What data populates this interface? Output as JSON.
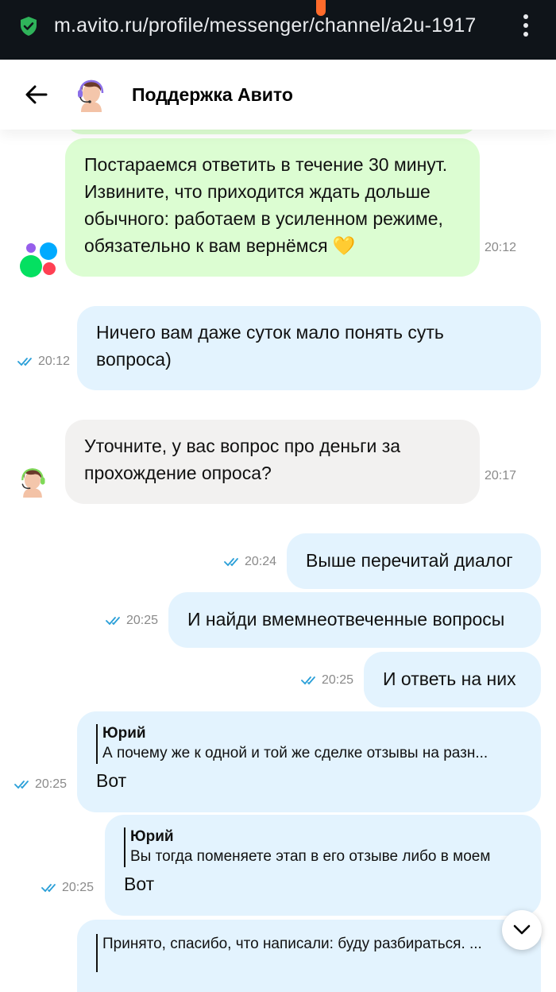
{
  "browser": {
    "url": "m.avito.ru/profile/messenger/channel/a2u-1917",
    "secure_icon": "shield-check-icon",
    "menu_icon": "kebab-menu-icon"
  },
  "header": {
    "title": "Поддержка Авито",
    "back_icon": "arrow-left-icon"
  },
  "messages": [
    {
      "dir": "in",
      "text": "Постараемся ответить в течение 30 минут. Извините, что приходится ждать дольше обычного: работаем в усиленном режиме, обязательно к вам вернёмся 💛",
      "time": "20:12"
    },
    {
      "dir": "out",
      "text": "Ничего вам даже суток мало понять суть вопроса)",
      "time": "20:12"
    },
    {
      "dir": "in",
      "text": "Уточните, у вас вопрос про деньги за прохождение опроса?",
      "time": "20:17"
    },
    {
      "dir": "out",
      "text": "Выше перечитай диалог",
      "time": "20:24"
    },
    {
      "dir": "out",
      "text": "И найди вмемнеотвеченные вопросы",
      "time": "20:25"
    },
    {
      "dir": "out",
      "text": "И ответь на них",
      "time": "20:25"
    },
    {
      "dir": "out",
      "quote_author": "Юрий",
      "quote_text": "А почему же к одной и той же сделке отзывы на разн...",
      "text": "Вот",
      "time": "20:25"
    },
    {
      "dir": "out",
      "quote_author": "Юрий",
      "quote_text": "Вы тогда поменяете этап в его отзыве либо в моем",
      "text": "Вот",
      "time": "20:25"
    },
    {
      "dir": "out",
      "quote_text": "Принято, спасибо, что написали: буду разбираться. ..."
    }
  ],
  "colors": {
    "incoming_green": "#dcfdd2",
    "incoming_gray": "#f2f1f0",
    "outgoing": "#e3f3fe",
    "read_ticks": "#2a9fd8"
  },
  "scroll_down_icon": "chevron-down-icon"
}
